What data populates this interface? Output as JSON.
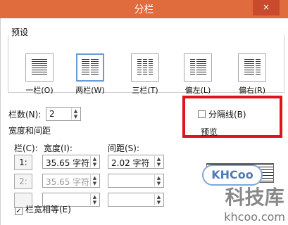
{
  "window": {
    "title": "分栏",
    "close_label": "×"
  },
  "presets": {
    "group_label": "预设",
    "items": [
      {
        "label": "一栏(O)",
        "cols": 1,
        "selected": false
      },
      {
        "label": "两栏(W)",
        "cols": 2,
        "selected": true
      },
      {
        "label": "三栏(T)",
        "cols": 3,
        "selected": false
      },
      {
        "label": "偏左(L)",
        "cols": 2,
        "selected": false
      },
      {
        "label": "偏右(R)",
        "cols": 2,
        "selected": false
      }
    ]
  },
  "column_count": {
    "label": "栏数(N):",
    "value": "2"
  },
  "width_spacing": {
    "section_label": "宽度和间距",
    "col_header": "栏(C):",
    "width_header": "宽度(I):",
    "spacing_header": "间距(S):",
    "rows": [
      {
        "num": "1:",
        "width": "35.65 字符",
        "spacing": "2.02 字符",
        "enabled": true
      },
      {
        "num": "2:",
        "width": "35.65 字符",
        "spacing": "",
        "enabled": false
      },
      {
        "num": "",
        "width": "",
        "spacing": "",
        "enabled": false
      }
    ]
  },
  "equal_width": {
    "label": "栏宽相等(E)",
    "checked": true
  },
  "separator": {
    "label": "分隔线(B)",
    "checked": false
  },
  "preview": {
    "label": "预览"
  },
  "watermark": {
    "logo": "KHCoo",
    "main": "科技库",
    "sub": "khcoo.com"
  }
}
